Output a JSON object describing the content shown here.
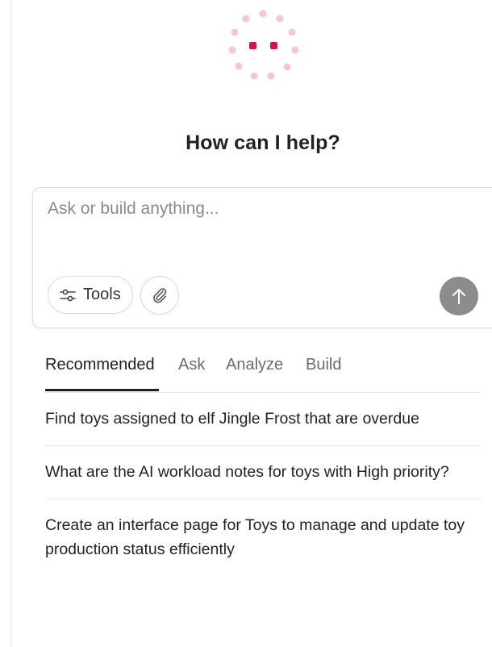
{
  "heading": "How can I help?",
  "composer": {
    "placeholder": "Ask or build anything...",
    "tools_label": "Tools"
  },
  "icons": {
    "logo": "loading-dots-icon",
    "tools": "sliders-icon",
    "attach": "paperclip-icon",
    "send": "arrow-up-icon"
  },
  "colors": {
    "logo_accent": "#d1144a",
    "logo_light": "#f7c6d4",
    "send_button": "#8c8c8c"
  },
  "tabs": [
    {
      "label": "Recommended",
      "active": true
    },
    {
      "label": "Ask",
      "active": false
    },
    {
      "label": "Analyze",
      "active": false
    },
    {
      "label": "Build",
      "active": false
    }
  ],
  "suggestions": [
    "Find toys assigned to elf Jingle Frost that are overdue",
    "What are the AI workload notes for toys with High priority?",
    "Create an interface page for Toys to manage and update toy production status efficiently"
  ]
}
